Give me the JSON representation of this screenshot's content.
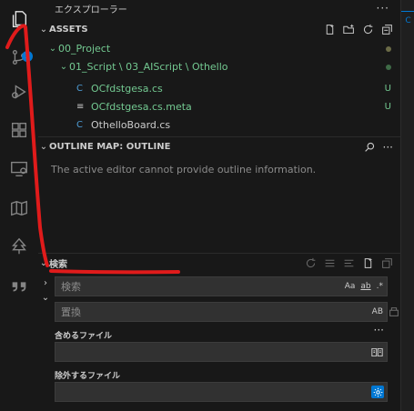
{
  "explorer": {
    "title": "エクスプローラー",
    "more": "···",
    "assets_header": "ASSETS",
    "tree": [
      {
        "label": "00_Project"
      },
      {
        "label": "01_Script \\ 03_AIScript \\ Othello"
      },
      {
        "label": "OCfdstgesa.cs",
        "decoration": "U"
      },
      {
        "label": "OCfdstgesa.cs.meta",
        "decoration": "U"
      },
      {
        "label": "OthelloBoard.cs"
      }
    ]
  },
  "outline": {
    "header": "OUTLINE MAP: OUTLINE",
    "message": "The active editor cannot provide outline information."
  },
  "search": {
    "header": "検索",
    "search_placeholder": "検索",
    "replace_placeholder": "置換",
    "case_label": "Aa",
    "word_label": "ab",
    "regex_label": ".*",
    "preserve_case_label": "AB",
    "include_label": "含めるファイル",
    "exclude_label": "除外するファイル",
    "more": "···"
  },
  "activity": {
    "badge": "1"
  },
  "colors": {
    "accent": "#0078d4",
    "untracked": "#73c991",
    "annotation": "#e01b1b"
  }
}
